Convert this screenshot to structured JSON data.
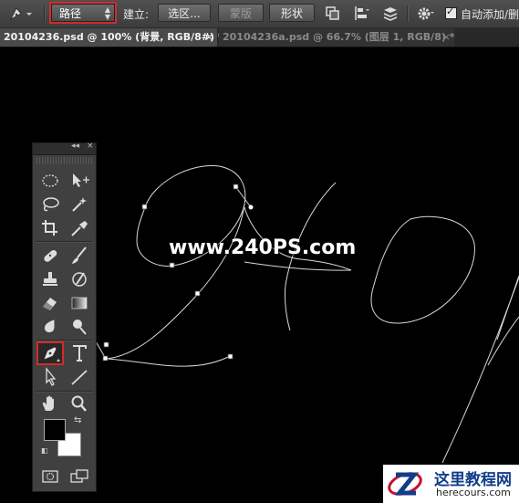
{
  "options_bar": {
    "mode_value": "路径",
    "build_label": "建立:",
    "selection_button": "选区...",
    "mask_button": "蒙版",
    "shape_button": "形状",
    "auto_add_label": "自动添加/删"
  },
  "tabs": [
    {
      "label": "20104236.psd @ 100% (背景, RGB/8#) *",
      "close": "×",
      "active": true
    },
    {
      "label": "20104236a.psd @ 66.7% (图层 1, RGB/8) *",
      "close": "×",
      "active": false
    }
  ],
  "tools_panel": {
    "collapse": "◂◂",
    "close": "×",
    "selected_tool": "pen-tool",
    "foreground_color": "#000000",
    "background_color": "#ffffff"
  },
  "canvas": {
    "watermark": "www.240PS.com",
    "site_logo_title": "这里教程网",
    "site_logo_url": "herecours.com"
  },
  "colors": {
    "highlight": "#d42a2a",
    "background": "#000000"
  }
}
